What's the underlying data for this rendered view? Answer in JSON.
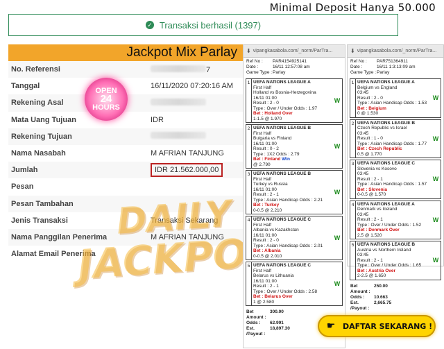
{
  "promo": {
    "top_text": "Minimal Deposit Hanya 50.000",
    "cta_label": "DAFTAR SEKARANG !"
  },
  "status": {
    "message": "Transaksi berhasil (1397)"
  },
  "banner": {
    "title": "Jackpot Mix Parlay"
  },
  "details": [
    {
      "label": "No. Referensi",
      "value": "7",
      "blurred": true
    },
    {
      "label": "Tanggal",
      "value": "16/11/2020 07:20:16 AM"
    },
    {
      "label": "Rekening Asal",
      "value": "",
      "blurred": true
    },
    {
      "label": "Mata Uang Tujuan",
      "value": "IDR"
    },
    {
      "label": "Rekening Tujuan",
      "value": "",
      "blurred": true
    },
    {
      "label": "Nama Nasabah",
      "value": "M AFRIAN TANJUNG"
    },
    {
      "label": "Jumlah",
      "value": "IDR 21.562.000,00",
      "highlight": true
    },
    {
      "label": "Pesan",
      "value": ""
    },
    {
      "label": "Pesan Tambahan",
      "value": ""
    },
    {
      "label": "Jenis Transaksi",
      "value": "Transaksi Sekarang"
    },
    {
      "label": "Nama Panggilan Penerima",
      "value": "M AFRIAN TANJUNG"
    },
    {
      "label": "Alamat Email Penerima",
      "value": ""
    }
  ],
  "open_sign": {
    "line1": "OPEN",
    "line2": "24",
    "line3": "HOURS"
  },
  "watermark": {
    "line1": "DAILY",
    "line2": "JACKPOT"
  },
  "tickets": [
    {
      "url": "vipangkasabola.com/_norm/ParTra...",
      "ref_no": "PAR4154925141",
      "date": "16/11 12:57:08 am",
      "game_type": "Parlay",
      "matches": [
        {
          "league": "UEFA NATIONS LEAGUE A",
          "half": "First Half",
          "teams": "Holland vs Bosnia-Herzegovina",
          "time": "16/11 01:00",
          "result": "Result : 2 - 0",
          "type": "Type : Over / Under",
          "odds": "Odds : 1.97",
          "bet": "Bet : Holland",
          "pick": "Over",
          "line": "1-1.5 @ 1.970",
          "outcome": "W"
        },
        {
          "league": "UEFA NATIONS LEAGUE B",
          "half": "First Half",
          "teams": "Bulgaria vs Finland",
          "time": "16/11 01:00",
          "result": "Result : 0 - 2",
          "type": "Type : 1X2",
          "odds": "Odds : 2.79",
          "bet": "Bet : Finland",
          "pick": "Win",
          "line": "@ 2.790",
          "outcome": "W"
        },
        {
          "league": "UEFA NATIONS LEAGUE B",
          "half": "First Half",
          "teams": "Turkey vs Russia",
          "time": "16/11 01:00",
          "result": "Result : 2 - 1",
          "type": "Type : Asian Handicap",
          "odds": "Odds : 2.21",
          "bet": "Bet : Turkey",
          "pick": "",
          "line": "0-0.5 @ 2.210",
          "outcome": "W"
        },
        {
          "league": "UEFA NATIONS LEAGUE C",
          "half": "First Half",
          "teams": "Albania vs Kazakhstan",
          "time": "16/11 01:00",
          "result": "Result : 2 - 0",
          "type": "Type : Asian Handicap",
          "odds": "Odds : 2.01",
          "bet": "Bet : Albania",
          "pick": "",
          "line": "0-0.5 @ 2.010",
          "outcome": "W"
        },
        {
          "league": "UEFA NATIONS LEAGUE C",
          "half": "First Half",
          "teams": "Belarus vs Lithuania",
          "time": "16/11 01:00",
          "result": "Result : 2 - 1",
          "type": "Type : Over / Under",
          "odds": "Odds : 2.58",
          "bet": "Bet : Belarus",
          "pick": "Over",
          "line": "1 @ 2.580",
          "outcome": "W"
        }
      ],
      "bet_amount": "300.00",
      "odds_total": "62.991",
      "est_payout": "18,897.30"
    },
    {
      "url": "vipangkasabola.com/_norm/ParTra...",
      "ref_no": "PAR751364911",
      "date": "16/11 1:3:13:09 am",
      "game_type": "Parlay",
      "matches": [
        {
          "league": "UEFA NATIONS LEAGUE A",
          "half": "",
          "teams": "Belgium vs England",
          "time": "03:45",
          "result": "Result : 2 - 0",
          "type": "Type : Asian Handicap",
          "odds": "Odds : 1.53",
          "bet": "Bet : Belgium",
          "pick": "",
          "line": "0 @ 1.530",
          "outcome": "W"
        },
        {
          "league": "UEFA NATIONS LEAGUE B",
          "half": "",
          "teams": "Czech Republic vs Israel",
          "time": "03:45",
          "result": "Result : 1 - 0",
          "type": "Type : Asian Handicap",
          "odds": "Odds : 1.77",
          "bet": "Bet : Czech Republic",
          "pick": "",
          "line": "0.5 @ 1.770",
          "outcome": "W"
        },
        {
          "league": "UEFA NATIONS LEAGUE C",
          "half": "",
          "teams": "Slovenia vs Kosovo",
          "time": "03:45",
          "result": "Result : 2 - 1",
          "type": "Type : Asian Handicap",
          "odds": "Odds : 1.57",
          "bet": "Bet : Slovenia",
          "pick": "",
          "line": "0-0.5 @ 1.570",
          "outcome": "W"
        },
        {
          "league": "UEFA NATIONS LEAGUE A",
          "half": "",
          "teams": "Denmark vs Iceland",
          "time": "03:45",
          "result": "Result : 2 - 1",
          "type": "Type : Over / Under",
          "odds": "Odds : 1.52",
          "bet": "Bet : Denmark",
          "pick": "Over",
          "line": "2.5 @ 1.520",
          "outcome": "W"
        },
        {
          "league": "UEFA NATIONS LEAGUE B",
          "half": "",
          "teams": "Austria vs Northern Ireland",
          "time": "03:45",
          "result": "Result : 2 - 1",
          "type": "Type : Over / Under",
          "odds": "Odds : 1.65",
          "bet": "Bet : Austria",
          "pick": "Over",
          "line": "2-2.5 @ 1.650",
          "outcome": "W"
        }
      ],
      "bet_amount": "250.00",
      "odds_total": "10.663",
      "est_payout": "2,665.75"
    }
  ],
  "ticket_labels": {
    "ref_no": "Ref No :",
    "date": "Date :",
    "game_type": "Game Type :",
    "bet_amount": "Bet Amount :",
    "odds": "Odds :",
    "est_payout": "Est. /Payout :"
  }
}
